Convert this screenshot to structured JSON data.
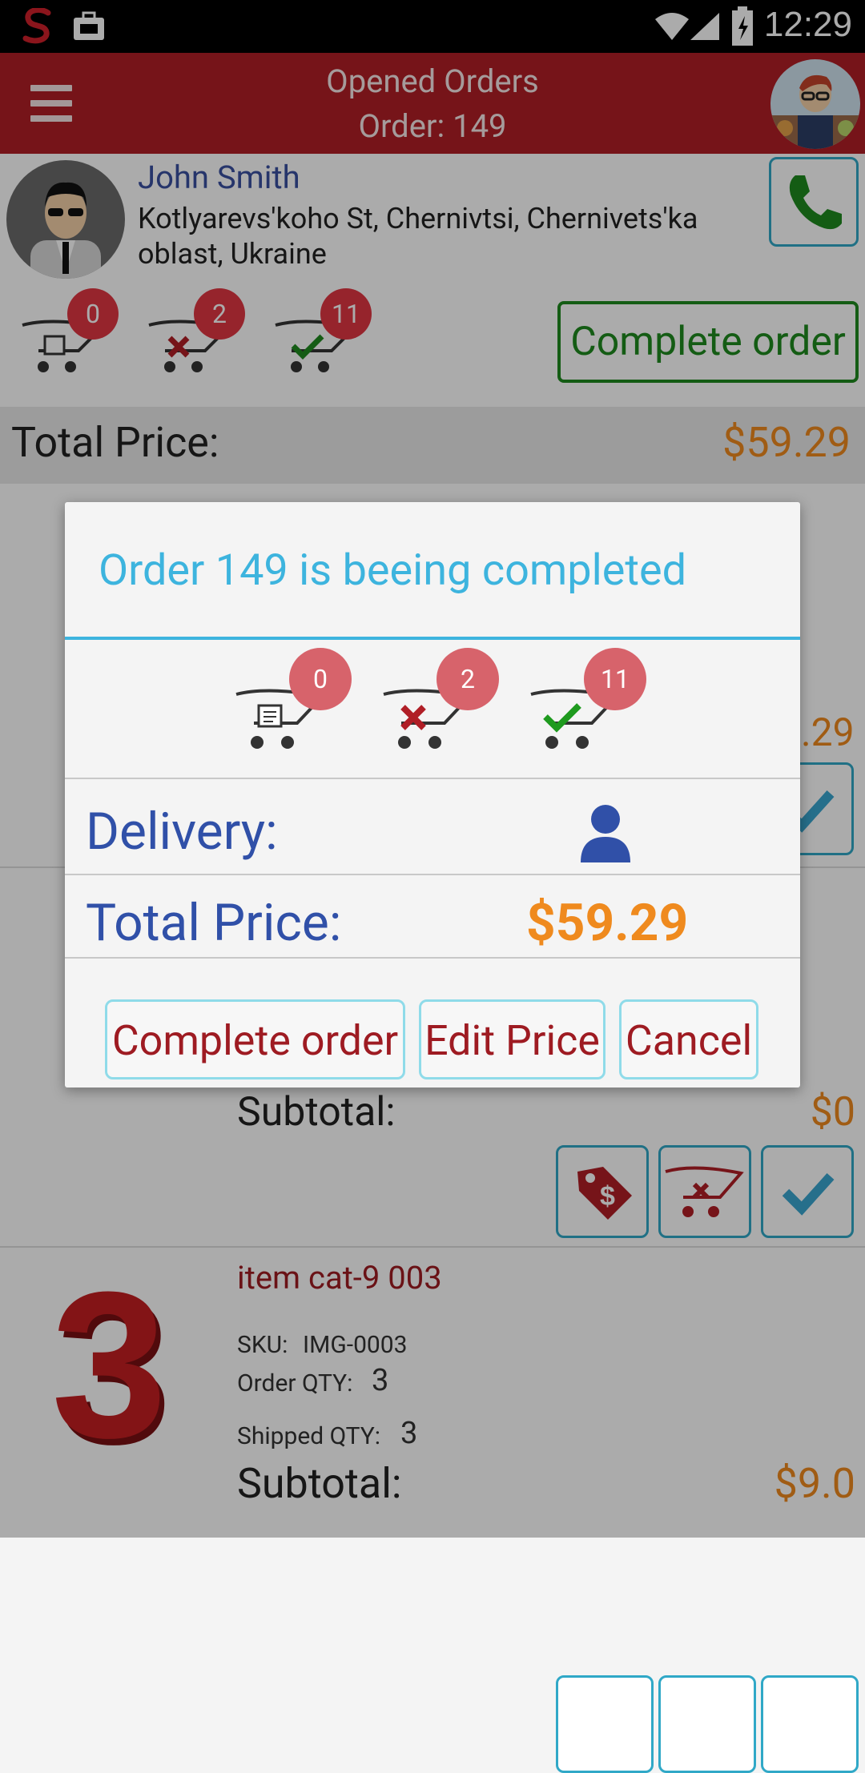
{
  "status_bar": {
    "time": "12:29"
  },
  "header": {
    "title": "Opened Orders",
    "subtitle": "Order: 149"
  },
  "customer": {
    "name": "John Smith",
    "address_line1": "Kotlyarevs'koho St, Chernivtsi, Chernivets'ka",
    "address_line2": "oblast, Ukraine"
  },
  "cart_counts": {
    "pending": "0",
    "rejected": "2",
    "accepted": "11"
  },
  "complete_button": "Complete order",
  "total": {
    "label": "Total Price:",
    "value": "$59.29"
  },
  "bg_fragments": {
    "price_partial": ".29"
  },
  "item2": {
    "subtotal_label": "Subtotal:",
    "subtotal_value": "$0"
  },
  "item3": {
    "number": "3",
    "name": "item cat-9 003",
    "sku_label": "SKU:",
    "sku_value": "IMG-0003",
    "order_qty_label": "Order QTY:",
    "order_qty_value": "3",
    "shipped_qty_label": "Shipped QTY:",
    "shipped_qty_value": "3",
    "subtotal_label": "Subtotal:",
    "subtotal_value": "$9.0"
  },
  "dialog": {
    "title": "Order 149 is beeing completed",
    "counts": {
      "pending": "0",
      "rejected": "2",
      "accepted": "11"
    },
    "delivery_label": "Delivery:",
    "total_label": "Total Price:",
    "total_value": "$59.29",
    "buttons": {
      "complete": "Complete order",
      "edit": "Edit Price",
      "cancel": "Cancel"
    }
  },
  "colors": {
    "header": "#b01e26",
    "accent_blue": "#3db4de",
    "price_orange": "#ef8a1e",
    "button_text": "#9e1b22",
    "badge": "#e03642"
  },
  "icons": [
    "app-logo-icon",
    "briefcase-icon",
    "wifi-icon",
    "signal-icon",
    "battery-icon",
    "menu-icon",
    "phone-icon",
    "cart-pending-icon",
    "cart-rejected-icon",
    "cart-accepted-icon",
    "user-icon",
    "price-tag-icon",
    "remove-from-cart-icon",
    "check-icon"
  ]
}
